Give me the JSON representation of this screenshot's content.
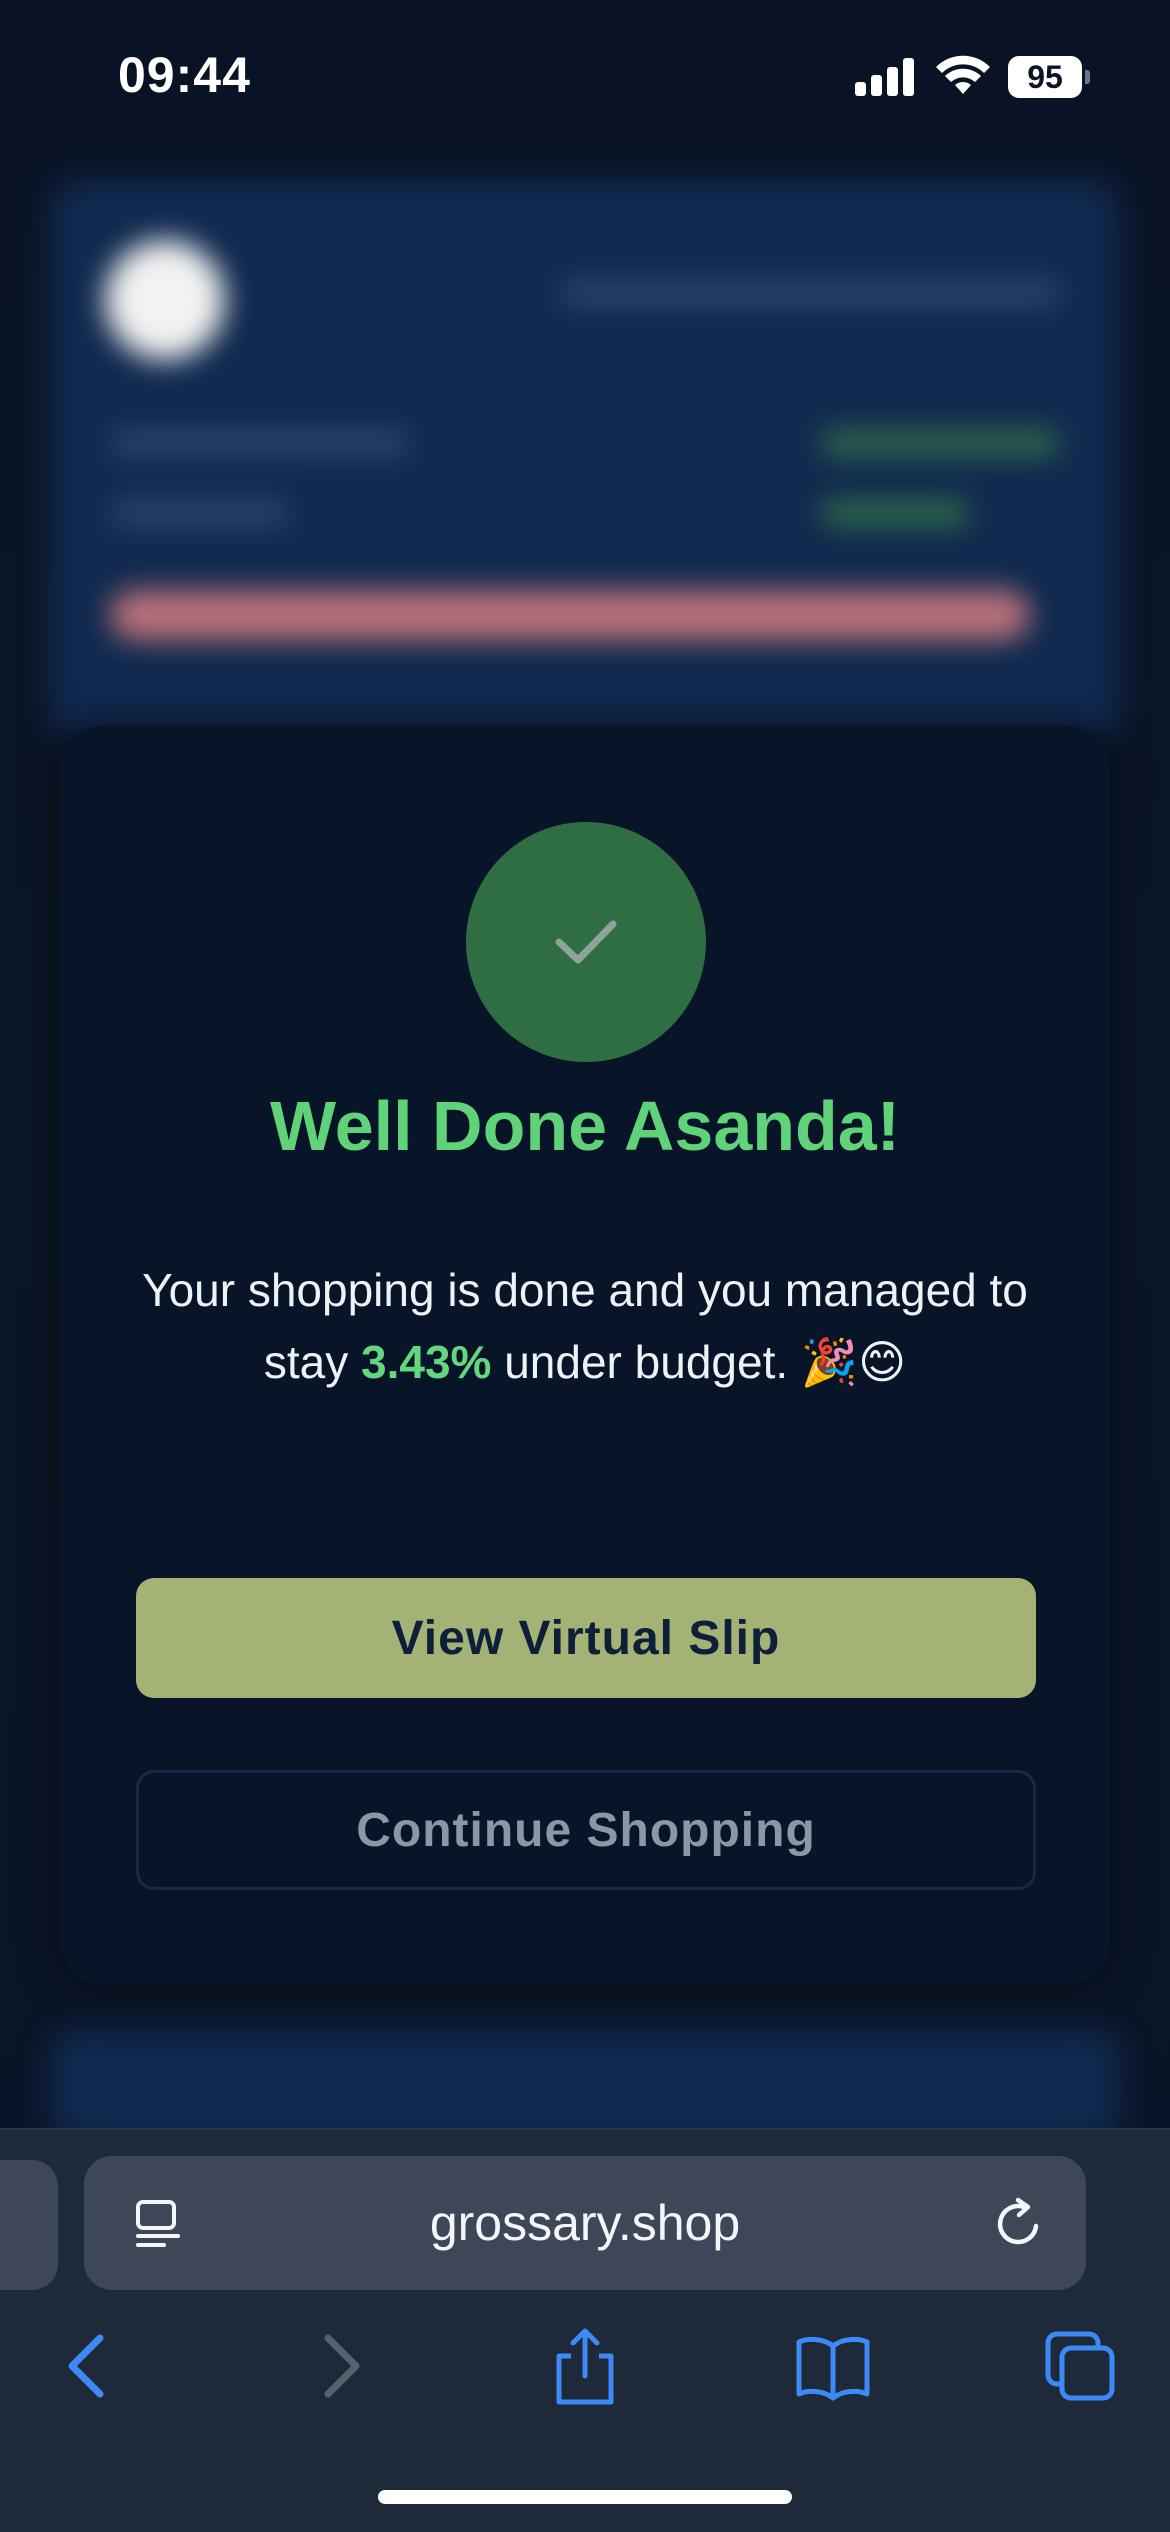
{
  "status_bar": {
    "time": "09:44",
    "battery": "95"
  },
  "modal": {
    "title": "Well Done Asanda!",
    "message_before": "Your shopping is done and you managed to stay ",
    "percent": "3.43%",
    "message_after": " under budget. 🎉😊",
    "primary_button": "View Virtual Slip",
    "secondary_button": "Continue Shopping",
    "colors": {
      "success": "#5fd27a",
      "check_bg": "#2f6e42",
      "primary_bg": "#a5b275"
    }
  },
  "browser": {
    "url": "grossary.shop",
    "icons": [
      "reader-icon",
      "reload-icon",
      "back-icon",
      "forward-icon",
      "share-icon",
      "bookmarks-icon",
      "tabs-icon"
    ]
  }
}
